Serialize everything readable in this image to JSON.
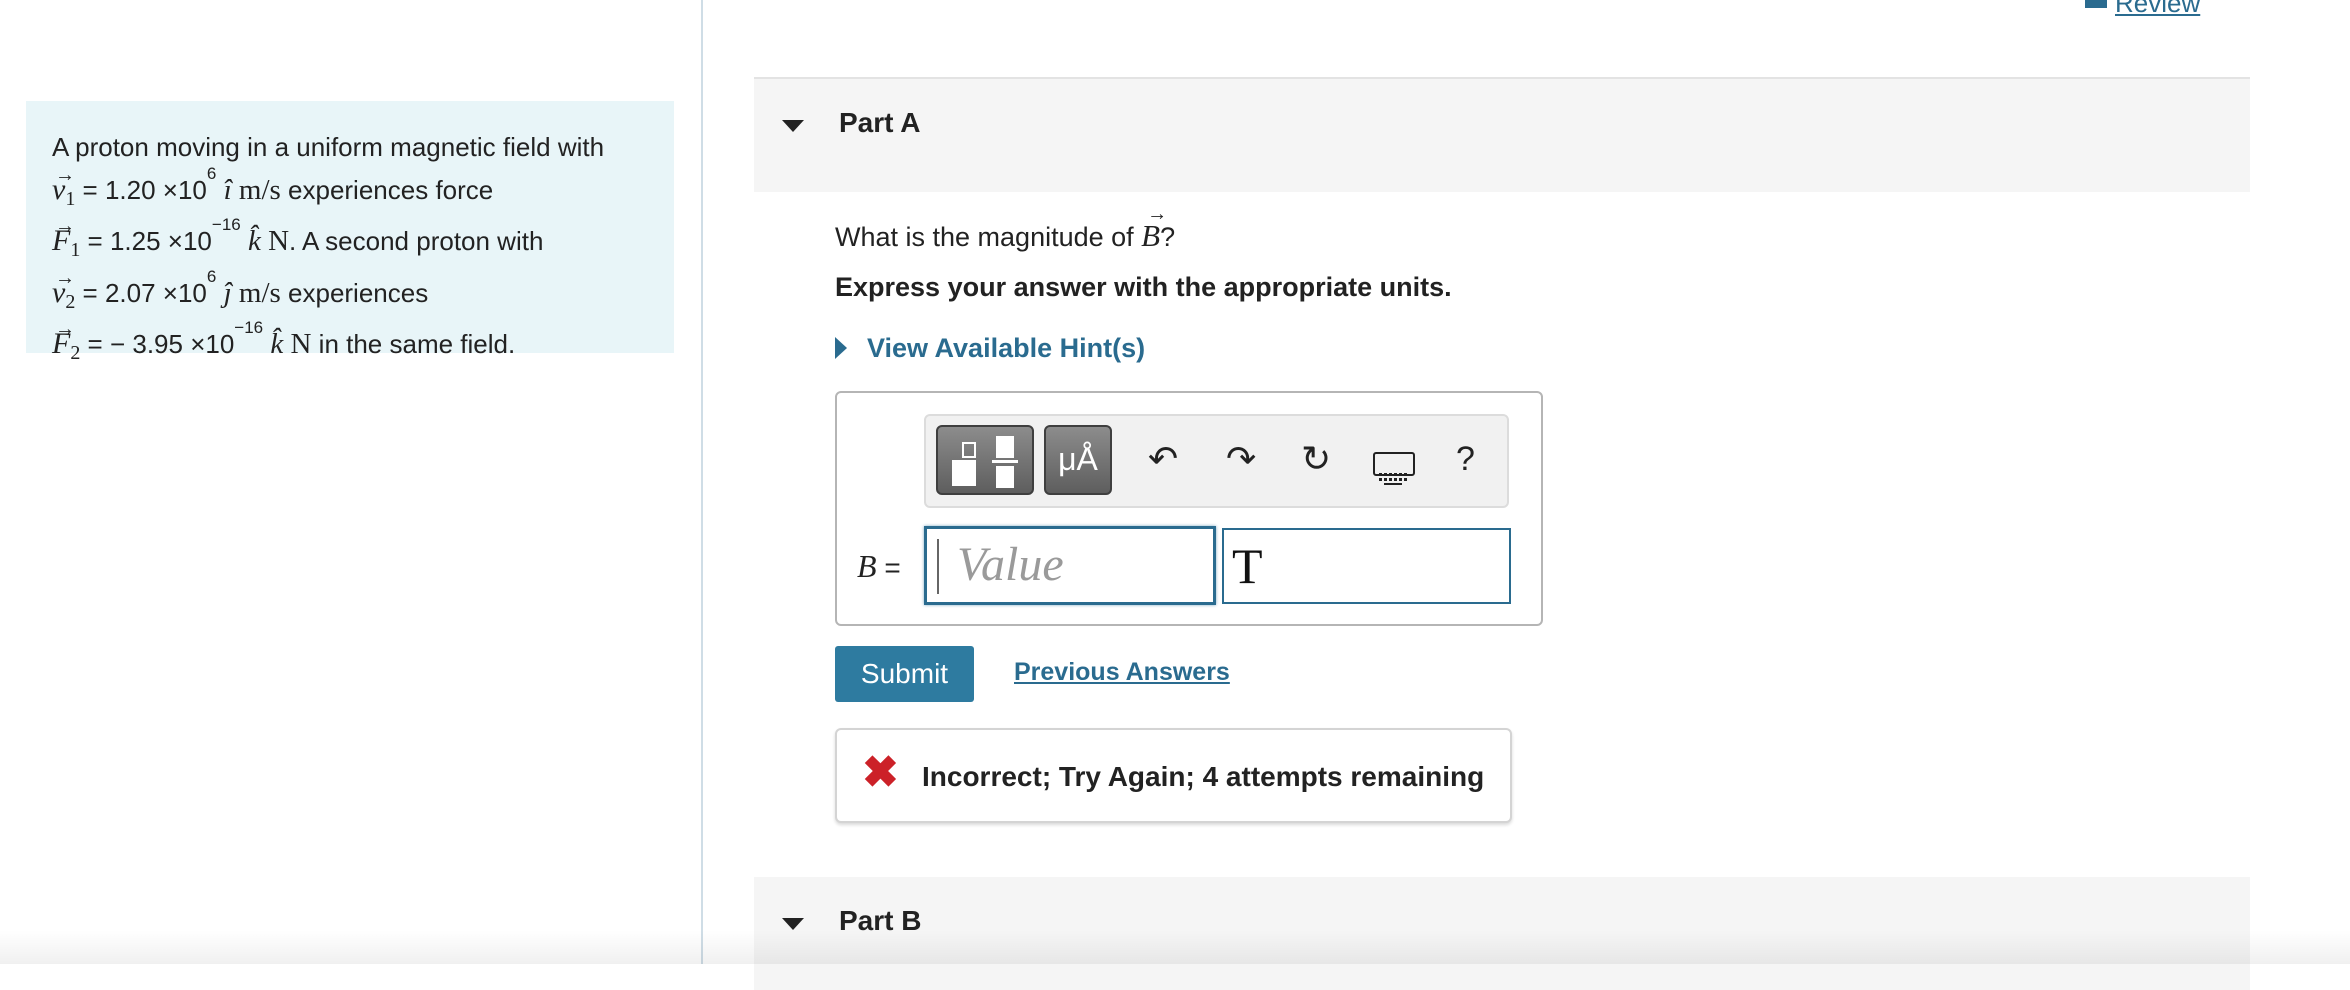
{
  "review_link": "Review",
  "problem": {
    "line1": "A proton moving in a uniform magnetic field with",
    "v1_sym": "v",
    "v1_sub": "1",
    "v1_value": " = 1.20 ×10",
    "v1_exp": "6",
    "v1_dir": "î",
    "v1_unit": "m/s",
    "v1_tail": " experiences force",
    "f1_sym": "F",
    "f1_sub": "1",
    "f1_value": " = 1.25 ×10",
    "f1_exp": "−16",
    "f1_dir": "k̂",
    "f1_unit": "N",
    "f1_tail": ". A second proton with",
    "v2_sym": "v",
    "v2_sub": "2",
    "v2_value": " = 2.07 ×10",
    "v2_exp": "6",
    "v2_dir": "ĵ",
    "v2_unit": "m/s",
    "v2_tail": " experiences",
    "f2_sym": "F",
    "f2_sub": "2",
    "f2_value": " = − 3.95 ×10",
    "f2_exp": "−16",
    "f2_dir": "k̂",
    "f2_unit": "N",
    "f2_tail": " in the same field."
  },
  "partA": {
    "title": "Part A",
    "question_pre": "What is the magnitude of ",
    "question_sym": "B",
    "question_post": "?",
    "instruction": "Express your answer with the appropriate units.",
    "hints_label": "View Available Hint(s)",
    "var_label": "B",
    "eq_sign": " =",
    "value_placeholder": "Value",
    "unit_value": "T",
    "toolbar": {
      "units_btn": "μÅ",
      "undo_icon": "↶",
      "redo_icon": "↷",
      "reset_icon": "↻",
      "help_icon": "?"
    },
    "submit_label": "Submit",
    "previous_answers_label": "Previous Answers",
    "feedback_icon": "✖",
    "feedback_text": "Incorrect; Try Again; 4 attempts remaining"
  },
  "partB": {
    "title": "Part B"
  },
  "colors": {
    "accent": "#2a6b8f",
    "submit_bg": "#2e7ba0",
    "error": "#cc2128",
    "problem_bg": "#e8f5f8"
  }
}
